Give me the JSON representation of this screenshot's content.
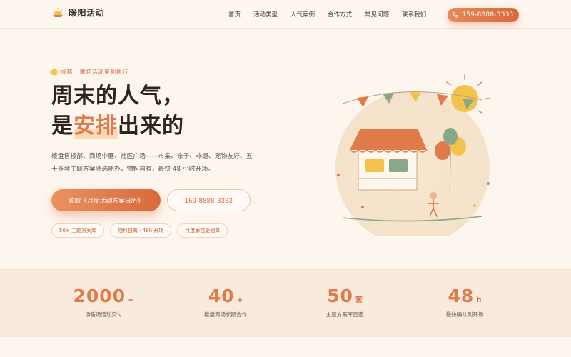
{
  "brand": {
    "name": "暖阳活动"
  },
  "nav": {
    "items": [
      "首页",
      "活动类型",
      "人气案例",
      "合作方式",
      "常见问题",
      "联系我们"
    ],
    "phone": "159-8888-3333"
  },
  "hero": {
    "tag": "成都 · 暖场活动策划执行",
    "title_line1": "周末的人气，",
    "title_line2_pre": "是",
    "title_line2_highlight": "安排",
    "title_line2_post": "出来的",
    "description": "楼盘售楼部、商场中庭、社区广场——市集、亲子、非遗、宠物友好、五十多套主题方案随选随办，物料自有，最快 48 小时开场。",
    "cta_primary": "领取《月度活动方案日历》",
    "cta_phone": "159-8888-3333",
    "chips": [
      "50+ 主题方案库",
      "物料自有 · 48h 开场",
      "月度承包更划算"
    ]
  },
  "stats": [
    {
      "value": "2000",
      "unit": "+",
      "label": "场暖场活动交付"
    },
    {
      "value": "40",
      "unit": "+",
      "label": "楼盘商场长期合作"
    },
    {
      "value": "50",
      "unit": "套",
      "label": "主题方案库直选"
    },
    {
      "value": "48",
      "unit": "h",
      "label": "最快确认到开场"
    }
  ],
  "colors": {
    "accent": "#e07a48",
    "accent_dark": "#d9693c",
    "background": "#fdf6ee",
    "sun": "#f3c24a",
    "green": "#8aa889"
  }
}
